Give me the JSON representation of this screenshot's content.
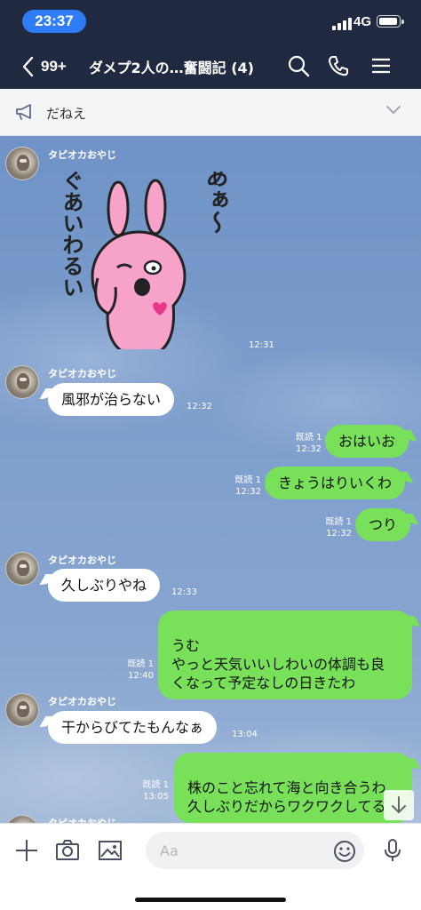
{
  "status_bar": {
    "time": "23:37",
    "network": "4G"
  },
  "header": {
    "back_count": "99+",
    "title": "ダメプ2人の…奮闘記 (4)",
    "icons": [
      "search-icon",
      "call-icon",
      "menu-icon"
    ]
  },
  "announcement": {
    "text": "だねえ",
    "icon": "megaphone-icon"
  },
  "sticker": {
    "text_right": "あぁ～",
    "text_left": "ぐあいわるい"
  },
  "messages": [
    {
      "sender": "タピオカおやじ",
      "type": "sticker",
      "time": "12:31"
    },
    {
      "sender": "タピオカおやじ",
      "text": "風邪が治らない",
      "time": "12:32"
    },
    {
      "text": "おはいお",
      "read": "既読 1",
      "time": "12:32"
    },
    {
      "text": "きょうはりいくわ",
      "read": "既読 1",
      "time": "12:32"
    },
    {
      "text": "つり",
      "read": "既読 1",
      "time": "12:32"
    },
    {
      "sender": "タピオカおやじ",
      "text": "久しぶりやね",
      "time": "12:33"
    },
    {
      "text": "うむ\nやっと天気いいしわいの体調も良\nくなって予定なしの日きたわ",
      "read": "既読 1",
      "time": "12:40"
    },
    {
      "sender": "タピオカおやじ",
      "text": "干からびてたもんなぁ",
      "time": "13:04"
    },
    {
      "text": "株のこと忘れて海と向き合うわ\n久しぶりだからワクワクしてる",
      "read": "既読 1",
      "time": "13:05"
    },
    {
      "sender": "タピオカおやじ"
    }
  ],
  "input": {
    "placeholder": "Aa"
  },
  "colors": {
    "header": "#1f2940",
    "bubble_out": "#79e05a",
    "bubble_in": "#ffffff",
    "time_pill": "#2f7df6"
  }
}
